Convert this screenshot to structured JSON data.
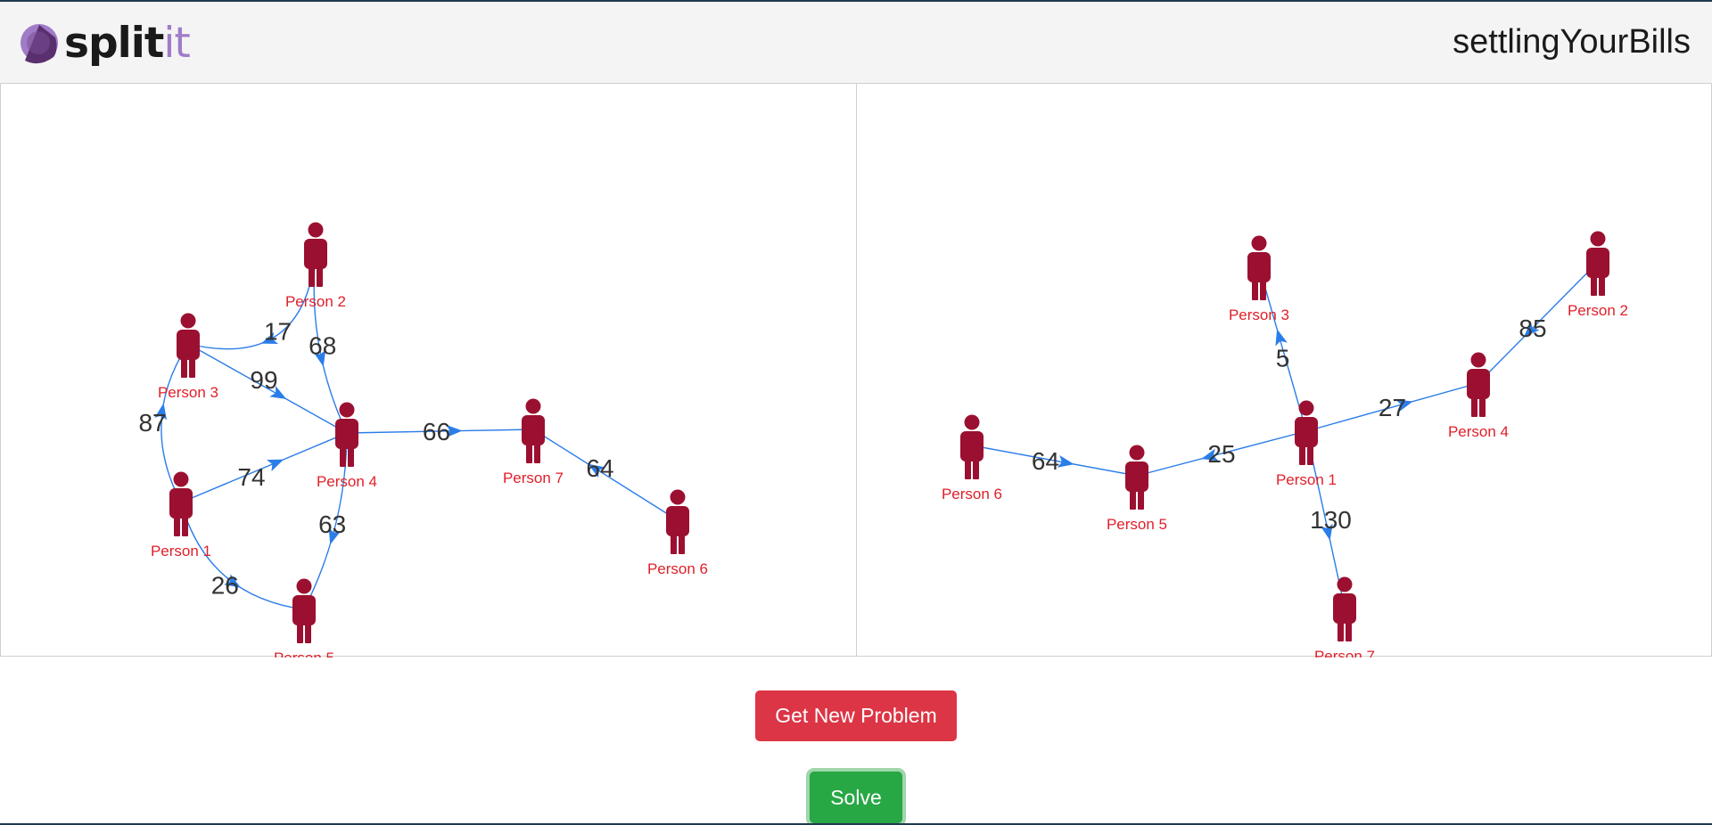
{
  "header": {
    "logo_main": "split",
    "logo_accent": "it",
    "title": "settlingYourBills"
  },
  "colors": {
    "person_icon": "#9b1030",
    "person_label": "#e0202a",
    "edge": "#2b7de9",
    "edge_label": "#333333",
    "danger_button": "#dc3545",
    "success_button": "#28a745"
  },
  "problem_graph": {
    "nodes": [
      {
        "id": "p1",
        "label": "Person 1"
      },
      {
        "id": "p2",
        "label": "Person 2"
      },
      {
        "id": "p3",
        "label": "Person 3"
      },
      {
        "id": "p4",
        "label": "Person 4"
      },
      {
        "id": "p5",
        "label": "Person 5"
      },
      {
        "id": "p6",
        "label": "Person 6"
      },
      {
        "id": "p7",
        "label": "Person 7"
      }
    ],
    "edges": [
      {
        "from": "p2",
        "to": "p3",
        "amount": "17"
      },
      {
        "from": "p2",
        "to": "p4",
        "amount": "68"
      },
      {
        "from": "p3",
        "to": "p4",
        "amount": "99"
      },
      {
        "from": "p1",
        "to": "p3",
        "amount": "87"
      },
      {
        "from": "p1",
        "to": "p4",
        "amount": "74"
      },
      {
        "from": "p4",
        "to": "p7",
        "amount": "66"
      },
      {
        "from": "p6",
        "to": "p7",
        "amount": "64"
      },
      {
        "from": "p4",
        "to": "p5",
        "amount": "63"
      },
      {
        "from": "p1",
        "to": "p5",
        "amount": "26"
      }
    ]
  },
  "solution_graph": {
    "nodes": [
      {
        "id": "p1",
        "label": "Person 1"
      },
      {
        "id": "p2",
        "label": "Person 2"
      },
      {
        "id": "p3",
        "label": "Person 3"
      },
      {
        "id": "p4",
        "label": "Person 4"
      },
      {
        "id": "p5",
        "label": "Person 5"
      },
      {
        "id": "p6",
        "label": "Person 6"
      },
      {
        "id": "p7",
        "label": "Person 7"
      }
    ],
    "edges": [
      {
        "from": "p1",
        "to": "p3",
        "amount": "5"
      },
      {
        "from": "p2",
        "to": "p4",
        "amount": "85"
      },
      {
        "from": "p1",
        "to": "p4",
        "amount": "27"
      },
      {
        "from": "p1",
        "to": "p5",
        "amount": "25"
      },
      {
        "from": "p6",
        "to": "p5",
        "amount": "64"
      },
      {
        "from": "p1",
        "to": "p7",
        "amount": "130"
      }
    ]
  },
  "buttons": {
    "new_problem": "Get New Problem",
    "solve": "Solve"
  }
}
